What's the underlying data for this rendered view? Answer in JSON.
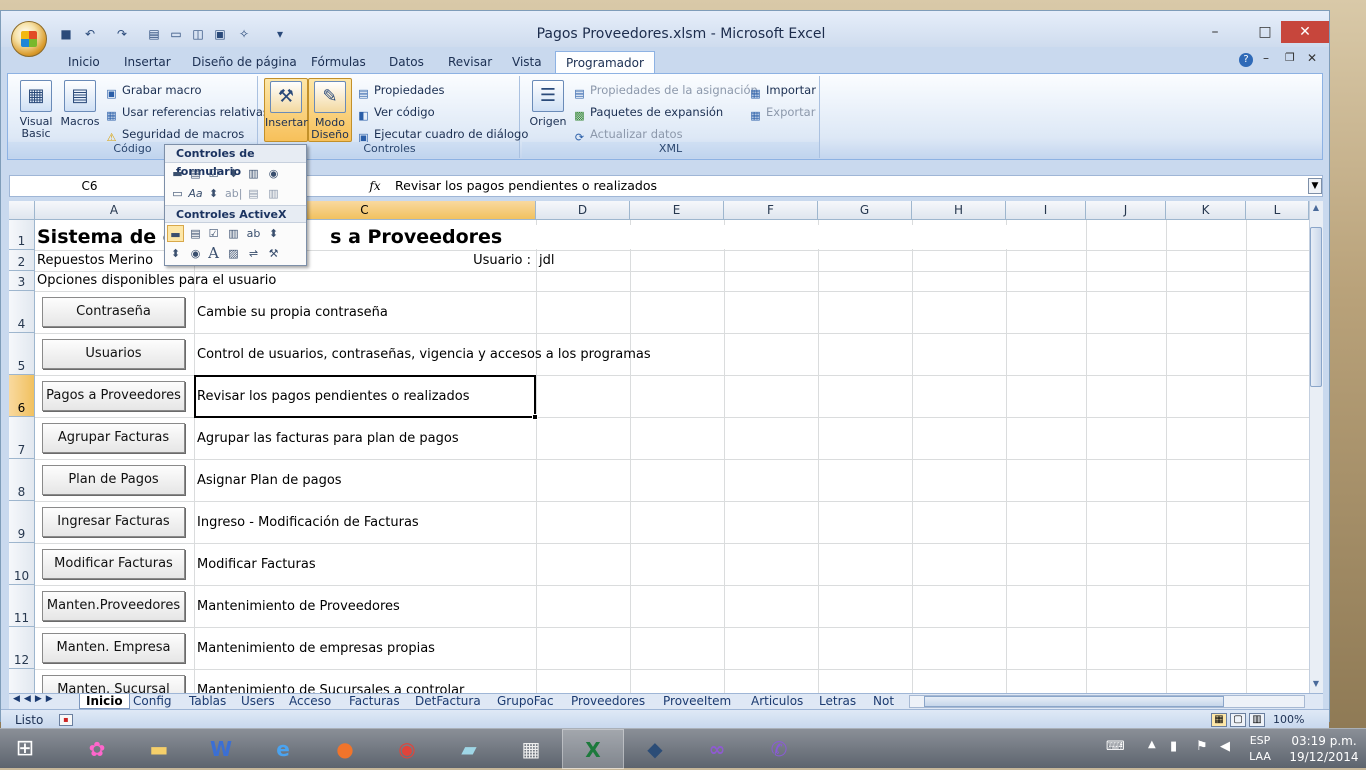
{
  "window": {
    "title": "Pagos Proveedores.xlsm - Microsoft Excel",
    "minimize": "–",
    "maximize": "□",
    "close": "✕"
  },
  "ribbon_tabs": [
    "Inicio",
    "Insertar",
    "Diseño de página",
    "Fórmulas",
    "Datos",
    "Revisar",
    "Vista",
    "Programador"
  ],
  "ribbon_tabs_active": "Programador",
  "ribbon": {
    "codigo": {
      "label": "Código",
      "visual_basic": "Visual Basic",
      "macros": "Macros",
      "grabar_macro": "Grabar macro",
      "usar_referencias": "Usar referencias relativas",
      "seguridad": "Seguridad de macros"
    },
    "controles": {
      "label": "Controles",
      "insertar": "Insertar",
      "modo_diseno": "Modo Diseño",
      "propiedades": "Propiedades",
      "ver_codigo": "Ver código",
      "ejecutar": "Ejecutar cuadro de diálogo"
    },
    "xml": {
      "label": "XML",
      "origen": "Origen",
      "prop_asignacion": "Propiedades de la asignación",
      "paquetes": "Paquetes de expansión",
      "actualizar": "Actualizar datos",
      "importar": "Importar",
      "exportar": "Exportar"
    }
  },
  "popup": {
    "form_controls": "Controles de formulario",
    "activex_controls": "Controles ActiveX"
  },
  "formula_bar": {
    "name_box": "C6",
    "fx": "fx",
    "formula": "Revisar los pagos pendientes o realizados"
  },
  "columns": [
    "A",
    "C",
    "D",
    "E",
    "F",
    "G",
    "H",
    "I",
    "J",
    "K",
    "L"
  ],
  "rows": [
    "1",
    "2",
    "3",
    "4",
    "5",
    "6",
    "7",
    "8",
    "9",
    "10",
    "11",
    "12"
  ],
  "sheet": {
    "title": "Sistema de co",
    "title_tail": "s a Proveedores",
    "company": "Repuestos Merino",
    "user_label": "Usuario :",
    "user_value": "jdl",
    "options_label": "Opciones disponibles para el usuario",
    "menu": [
      {
        "button": "Contraseña",
        "desc": "Cambie su propia contraseña"
      },
      {
        "button": "Usuarios",
        "desc": "Control de usuarios, contraseñas, vigencia y accesos a los programas"
      },
      {
        "button": "Pagos a Proveedores",
        "desc": "Revisar los pagos pendientes o realizados"
      },
      {
        "button": "Agrupar Facturas",
        "desc": "Agrupar las facturas para plan de pagos"
      },
      {
        "button": "Plan de Pagos",
        "desc": "Asignar Plan de pagos"
      },
      {
        "button": "Ingresar Facturas",
        "desc": "Ingreso - Modificación de Facturas"
      },
      {
        "button": "Modificar Facturas",
        "desc": "Modificar Facturas"
      },
      {
        "button": "Manten.Proveedores",
        "desc": "Mantenimiento de Proveedores"
      },
      {
        "button": "Manten. Empresa",
        "desc": "Mantenimiento de empresas propias"
      },
      {
        "button": "Manten. Sucursal",
        "desc": "Mantenimiento de Sucursales a controlar"
      }
    ]
  },
  "sheet_tabs": [
    "Inicio",
    "Config",
    "Tablas",
    "Users",
    "Acceso",
    "Facturas",
    "DetFactura",
    "GrupoFac",
    "Proveedores",
    "ProveeItem",
    "Articulos",
    "Letras",
    "Not"
  ],
  "sheet_tabs_active": "Inicio",
  "status": {
    "ready": "Listo",
    "zoom": "100%"
  },
  "taskbar": {
    "lang": "ESP",
    "region": "LAA",
    "time": "03:19 p.m.",
    "date": "19/12/2014"
  },
  "colors": {
    "accent": "#c3d5ee",
    "active_tab": "#fdfeff",
    "selection": "#f1c15f"
  }
}
